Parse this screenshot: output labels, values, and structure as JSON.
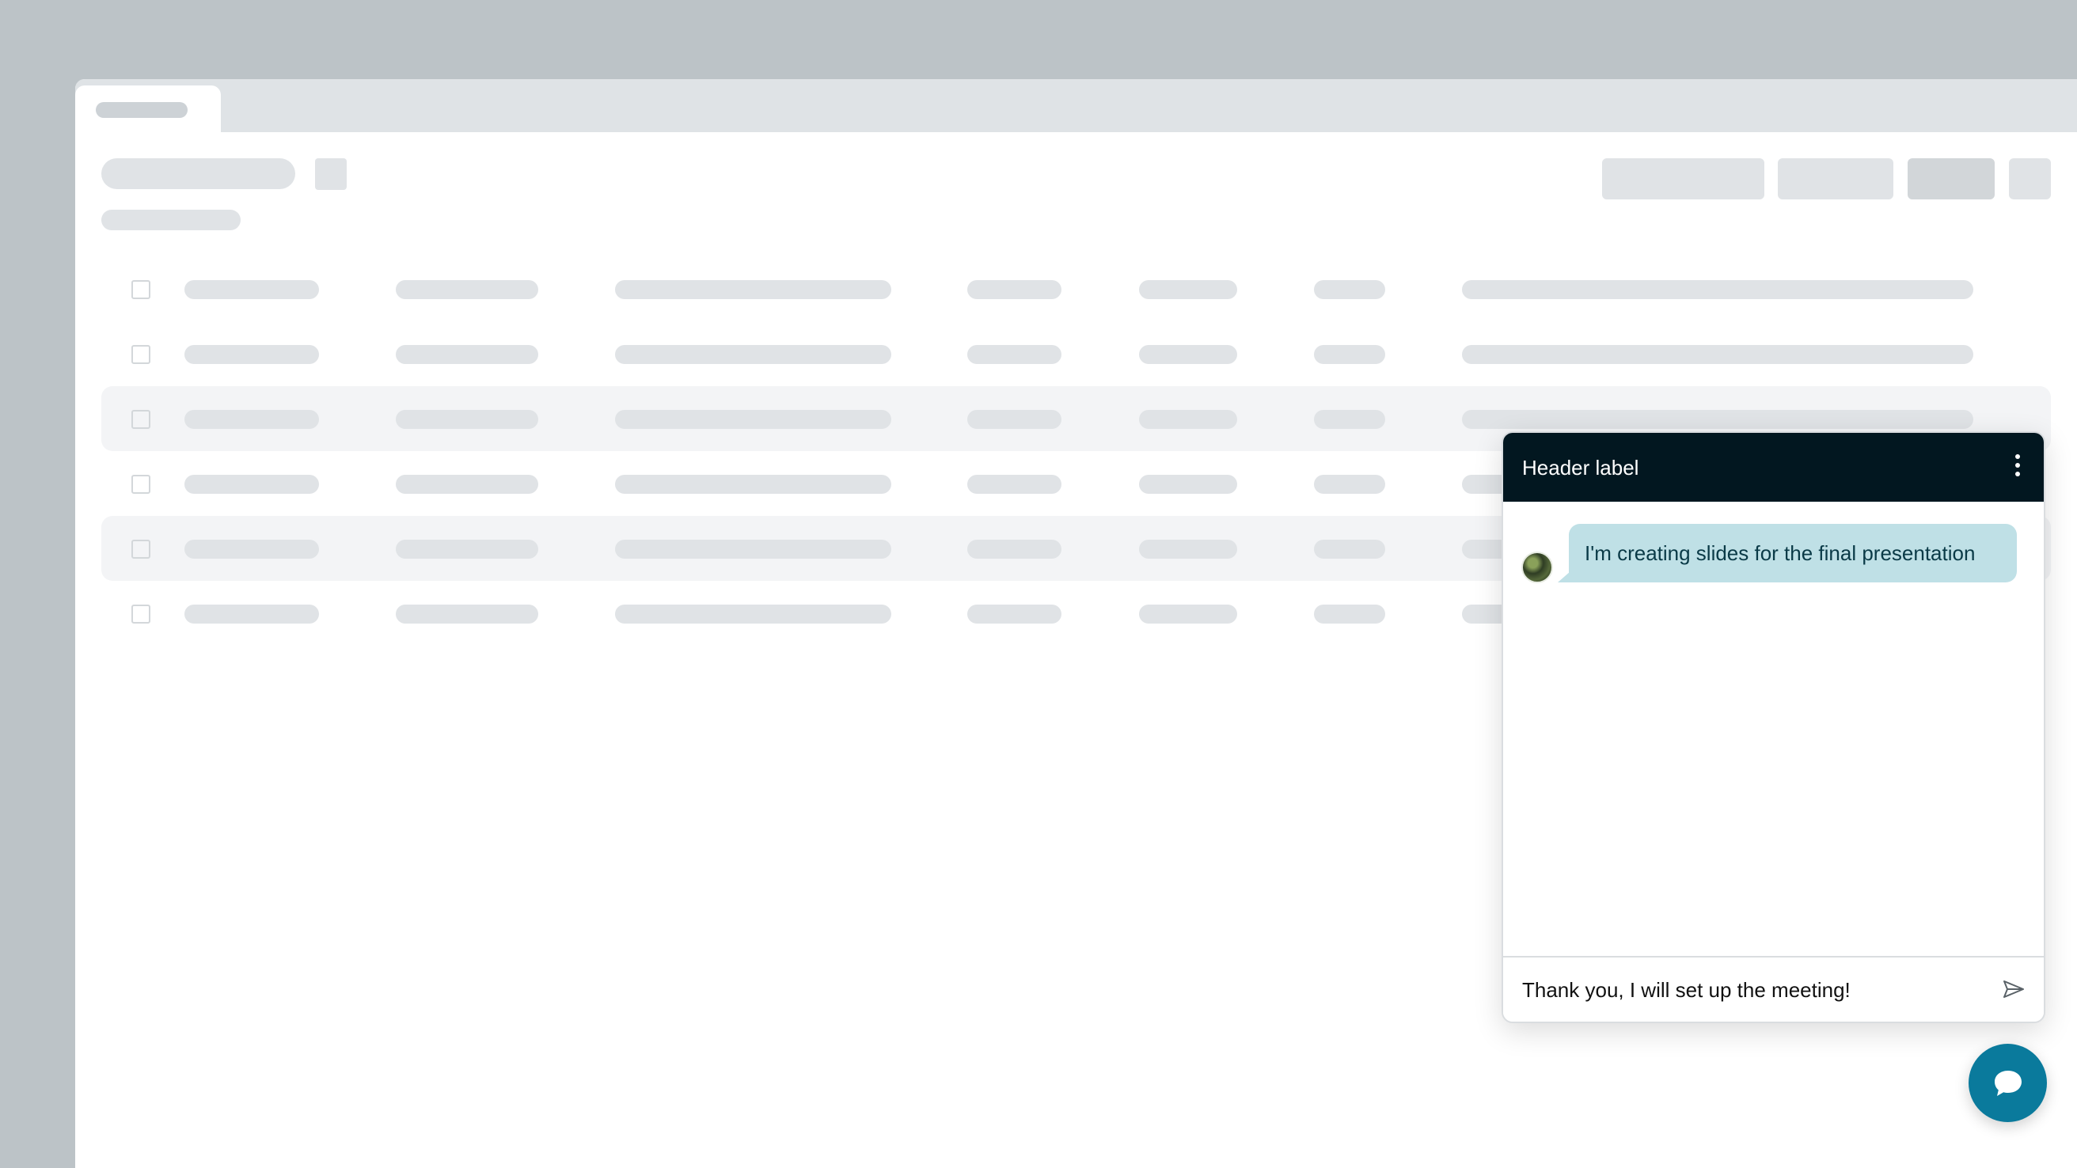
{
  "chat": {
    "header_label": "Header label",
    "messages": [
      {
        "text": "I'm creating slides for the final presentation"
      }
    ],
    "composer_value": "Thank you, I will set up the meeting!"
  },
  "icons": {
    "menu": "more-vertical-icon",
    "send": "send-icon",
    "chat_launcher": "chat-bubble-icon"
  },
  "colors": {
    "chat_header_bg": "#021720",
    "message_bubble_bg": "#bfe0e6",
    "launcher_bg": "#0a7a9c",
    "placeholder": "#e0e3e6"
  }
}
